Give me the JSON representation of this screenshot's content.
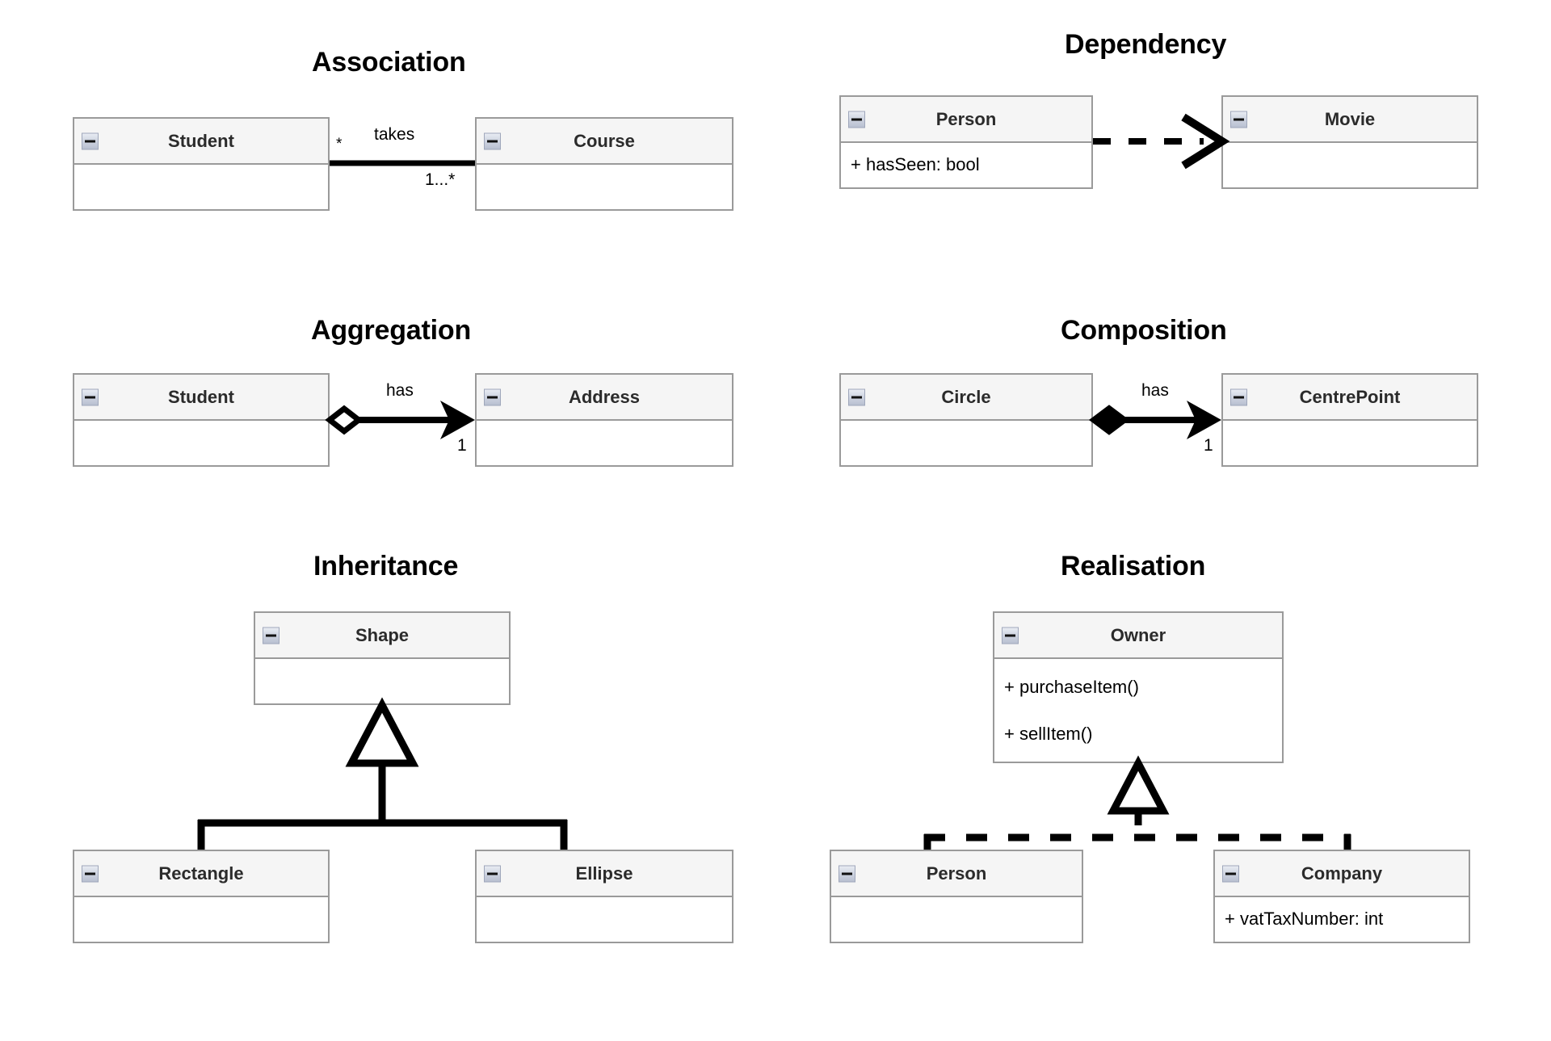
{
  "diagram": {
    "kind": "uml-class-relationship-cheatsheet",
    "background": "#ffffff",
    "box_fill": "#ffffff",
    "header_fill": "#f5f5f5",
    "border_color": "#9a9a9a",
    "line_color": "#000000"
  },
  "sections": {
    "association": {
      "title": "Association",
      "classes": {
        "student": {
          "name": "Student",
          "members": []
        },
        "course": {
          "name": "Course",
          "members": []
        }
      },
      "edge": {
        "type": "association",
        "label": "takes",
        "source_multiplicity": "*",
        "target_multiplicity": "1...*",
        "line_style": "solid",
        "source_decoration": "none",
        "target_decoration": "none"
      }
    },
    "dependency": {
      "title": "Dependency",
      "classes": {
        "person": {
          "name": "Person",
          "members": [
            "+ hasSeen: bool"
          ]
        },
        "movie": {
          "name": "Movie",
          "members": []
        }
      },
      "edge": {
        "type": "dependency",
        "label": "",
        "line_style": "dashed",
        "source_decoration": "none",
        "target_decoration": "open-arrow"
      }
    },
    "aggregation": {
      "title": "Aggregation",
      "classes": {
        "student": {
          "name": "Student",
          "members": []
        },
        "address": {
          "name": "Address",
          "members": []
        }
      },
      "edge": {
        "type": "aggregation",
        "label": "has",
        "target_multiplicity": "1",
        "line_style": "solid",
        "source_decoration": "hollow-diamond",
        "target_decoration": "solid-arrow"
      }
    },
    "composition": {
      "title": "Composition",
      "classes": {
        "circle": {
          "name": "Circle",
          "members": []
        },
        "centrepoint": {
          "name": "CentrePoint",
          "members": []
        }
      },
      "edge": {
        "type": "composition",
        "label": "has",
        "target_multiplicity": "1",
        "line_style": "solid",
        "source_decoration": "filled-diamond",
        "target_decoration": "solid-arrow"
      }
    },
    "inheritance": {
      "title": "Inheritance",
      "classes": {
        "shape": {
          "name": "Shape",
          "members": []
        },
        "rectangle": {
          "name": "Rectangle",
          "members": []
        },
        "ellipse": {
          "name": "Ellipse",
          "members": []
        }
      },
      "edge": {
        "type": "generalization",
        "line_style": "solid",
        "target_decoration": "hollow-triangle"
      }
    },
    "realisation": {
      "title": "Realisation",
      "classes": {
        "owner": {
          "name": "Owner",
          "members": [
            "+ purchaseItem()",
            "+ sellItem()"
          ]
        },
        "person": {
          "name": "Person",
          "members": []
        },
        "company": {
          "name": "Company",
          "members": [
            "+ vatTaxNumber: int"
          ]
        }
      },
      "edge": {
        "type": "realization",
        "line_style": "dashed",
        "target_decoration": "hollow-triangle"
      }
    }
  },
  "icons": {
    "collapse": "collapse-minus-icon"
  }
}
